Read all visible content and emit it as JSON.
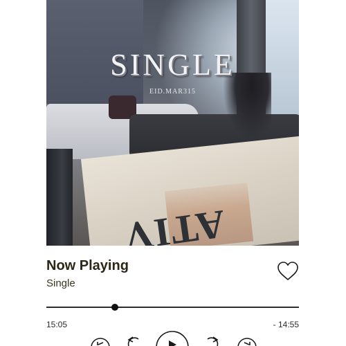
{
  "album": {
    "title": "SINGLE",
    "subtitle": "EID.MAR315",
    "cover_letters": "ATIV"
  },
  "track": {
    "title": "Now Playing",
    "artist": "Single",
    "liked": false
  },
  "playback": {
    "elapsed": "15:05",
    "remaining": "- 14:55",
    "progress_fraction": 0.27,
    "state": "paused"
  },
  "icons": {
    "like": "heart-outline-icon",
    "previous": "previous-track-icon",
    "rewind": "rewind-15-icon",
    "play": "play-icon",
    "forward": "forward-15-icon",
    "next": "next-track-icon"
  },
  "colors": {
    "text_primary": "#2b2718",
    "control": "#1a1a1a",
    "background": "#ffffff"
  }
}
